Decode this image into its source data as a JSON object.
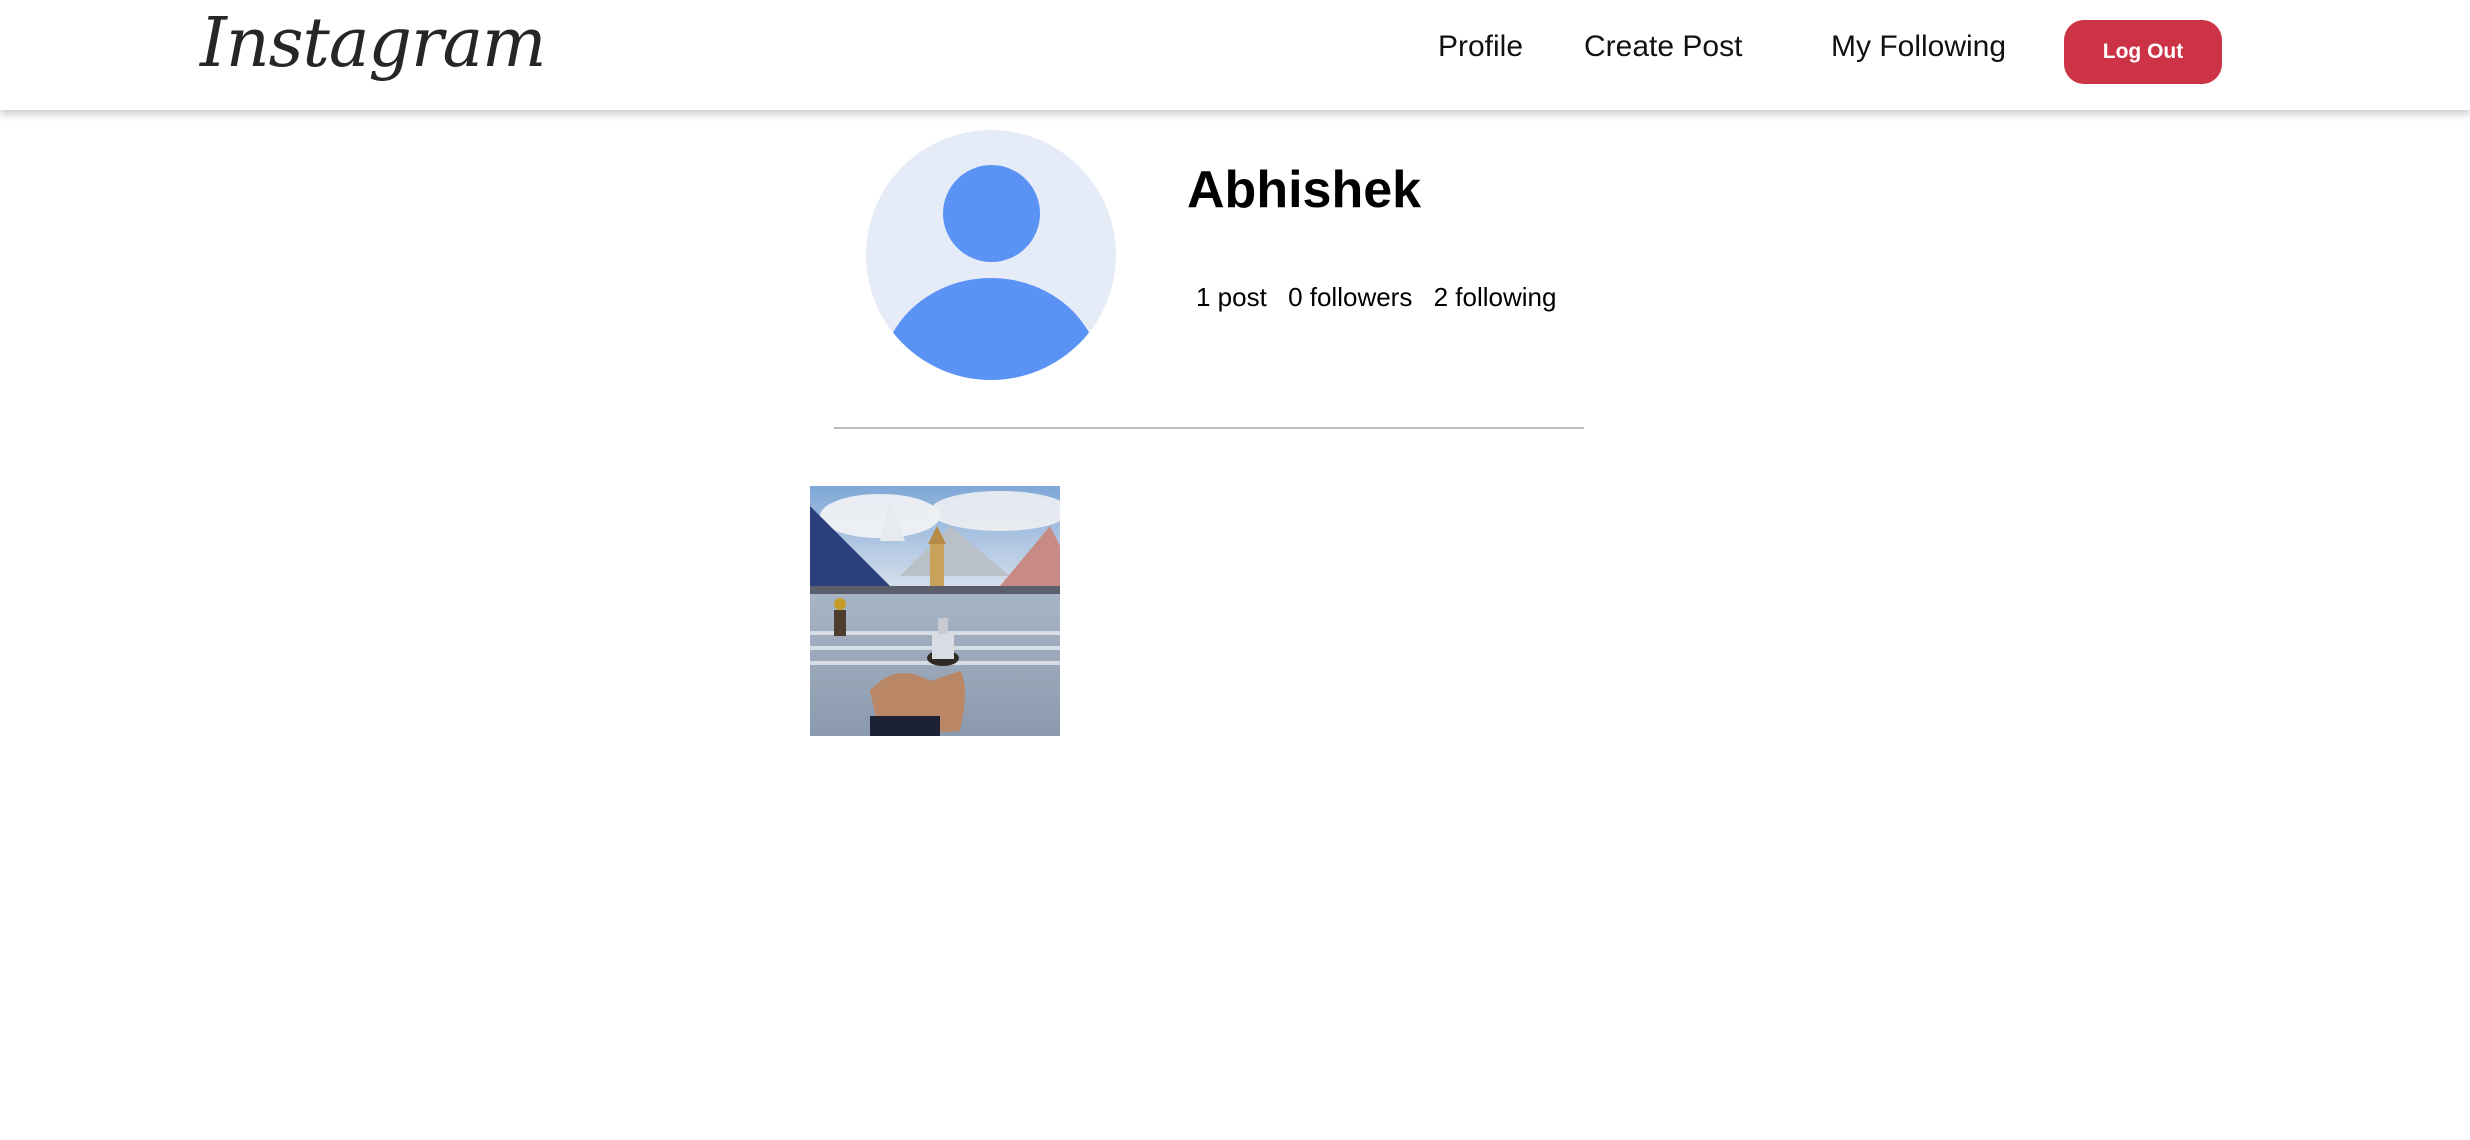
{
  "header": {
    "logo_text": "Instagram",
    "nav": {
      "profile": "Profile",
      "create_post": "Create Post",
      "my_following": "My Following"
    },
    "logout_label": "Log Out"
  },
  "profile": {
    "username": "Abhishek",
    "stats": {
      "posts": "1 post",
      "followers": "0 followers",
      "following": "2 following"
    }
  },
  "posts": [
    {
      "image": "photo of a hand holding a small temple figurine in front of a mountain temple"
    }
  ],
  "colors": {
    "logout_button": "#cd3347",
    "avatar_background": "#e6ebf8",
    "avatar_figure": "#5b93f5",
    "divider": "#bdbdbd"
  }
}
